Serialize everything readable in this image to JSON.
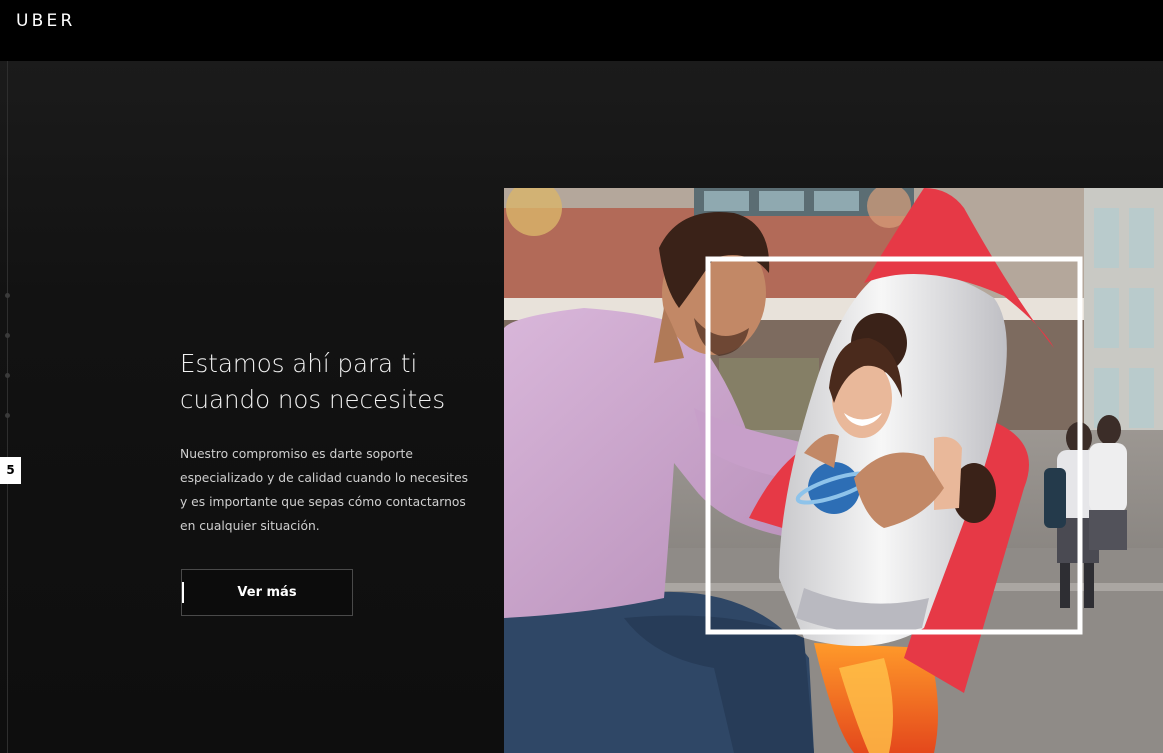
{
  "header": {
    "logo_text": "UBER"
  },
  "slider": {
    "current_slide": "5"
  },
  "hero": {
    "headline": "Estamos ahí para ti cuando nos necesites",
    "body": "Nuestro compromiso es darte soporte especializado y de calidad cuando lo necesites y es importante que sepas cómo contactarnos en cualquier situación.",
    "cta_label": "Ver más"
  },
  "colors": {
    "topbar": "#000000",
    "background": "#121212",
    "text": "#ffffff",
    "rocket_red": "#e63946"
  }
}
